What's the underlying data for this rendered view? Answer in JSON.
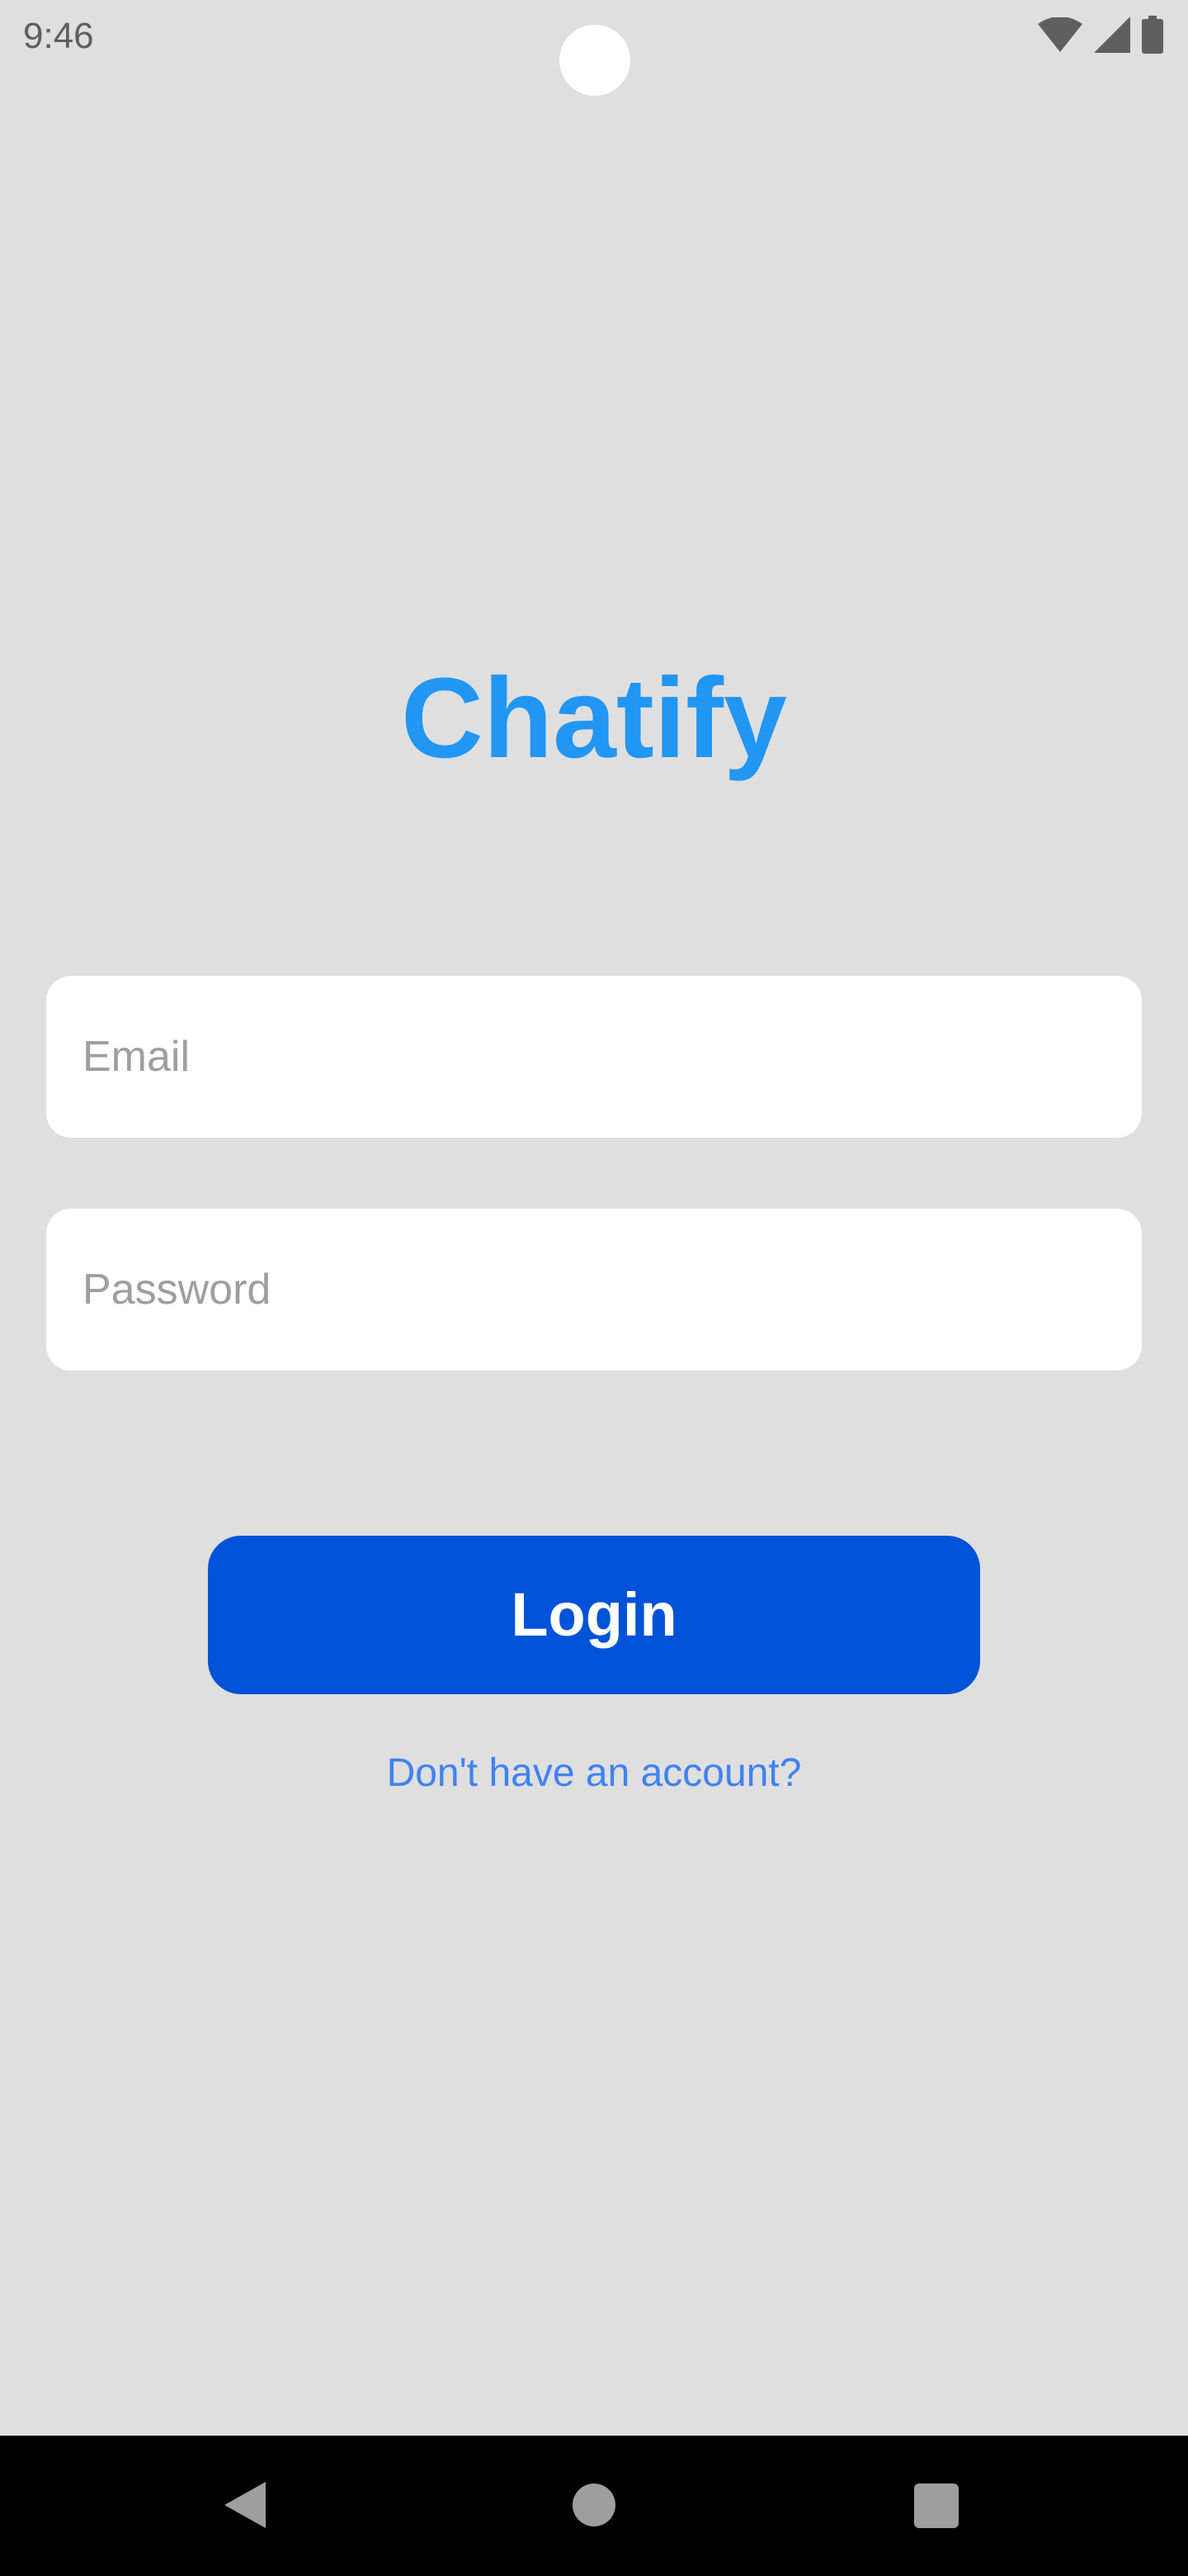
{
  "status_bar": {
    "time": "9:46",
    "icons": [
      "wifi-icon",
      "cellular-signal-icon",
      "battery-icon"
    ]
  },
  "app": {
    "title": "Chatify",
    "title_color": "#2196f3"
  },
  "form": {
    "email_placeholder": "Email",
    "email_value": "",
    "password_placeholder": "Password",
    "password_value": ""
  },
  "actions": {
    "login_label": "Login",
    "login_color": "#0052d9",
    "signup_link": "Don't have an account?",
    "link_color": "#3f82f2"
  },
  "nav_bar": {
    "buttons": [
      "back-icon",
      "home-icon",
      "recents-icon"
    ]
  }
}
